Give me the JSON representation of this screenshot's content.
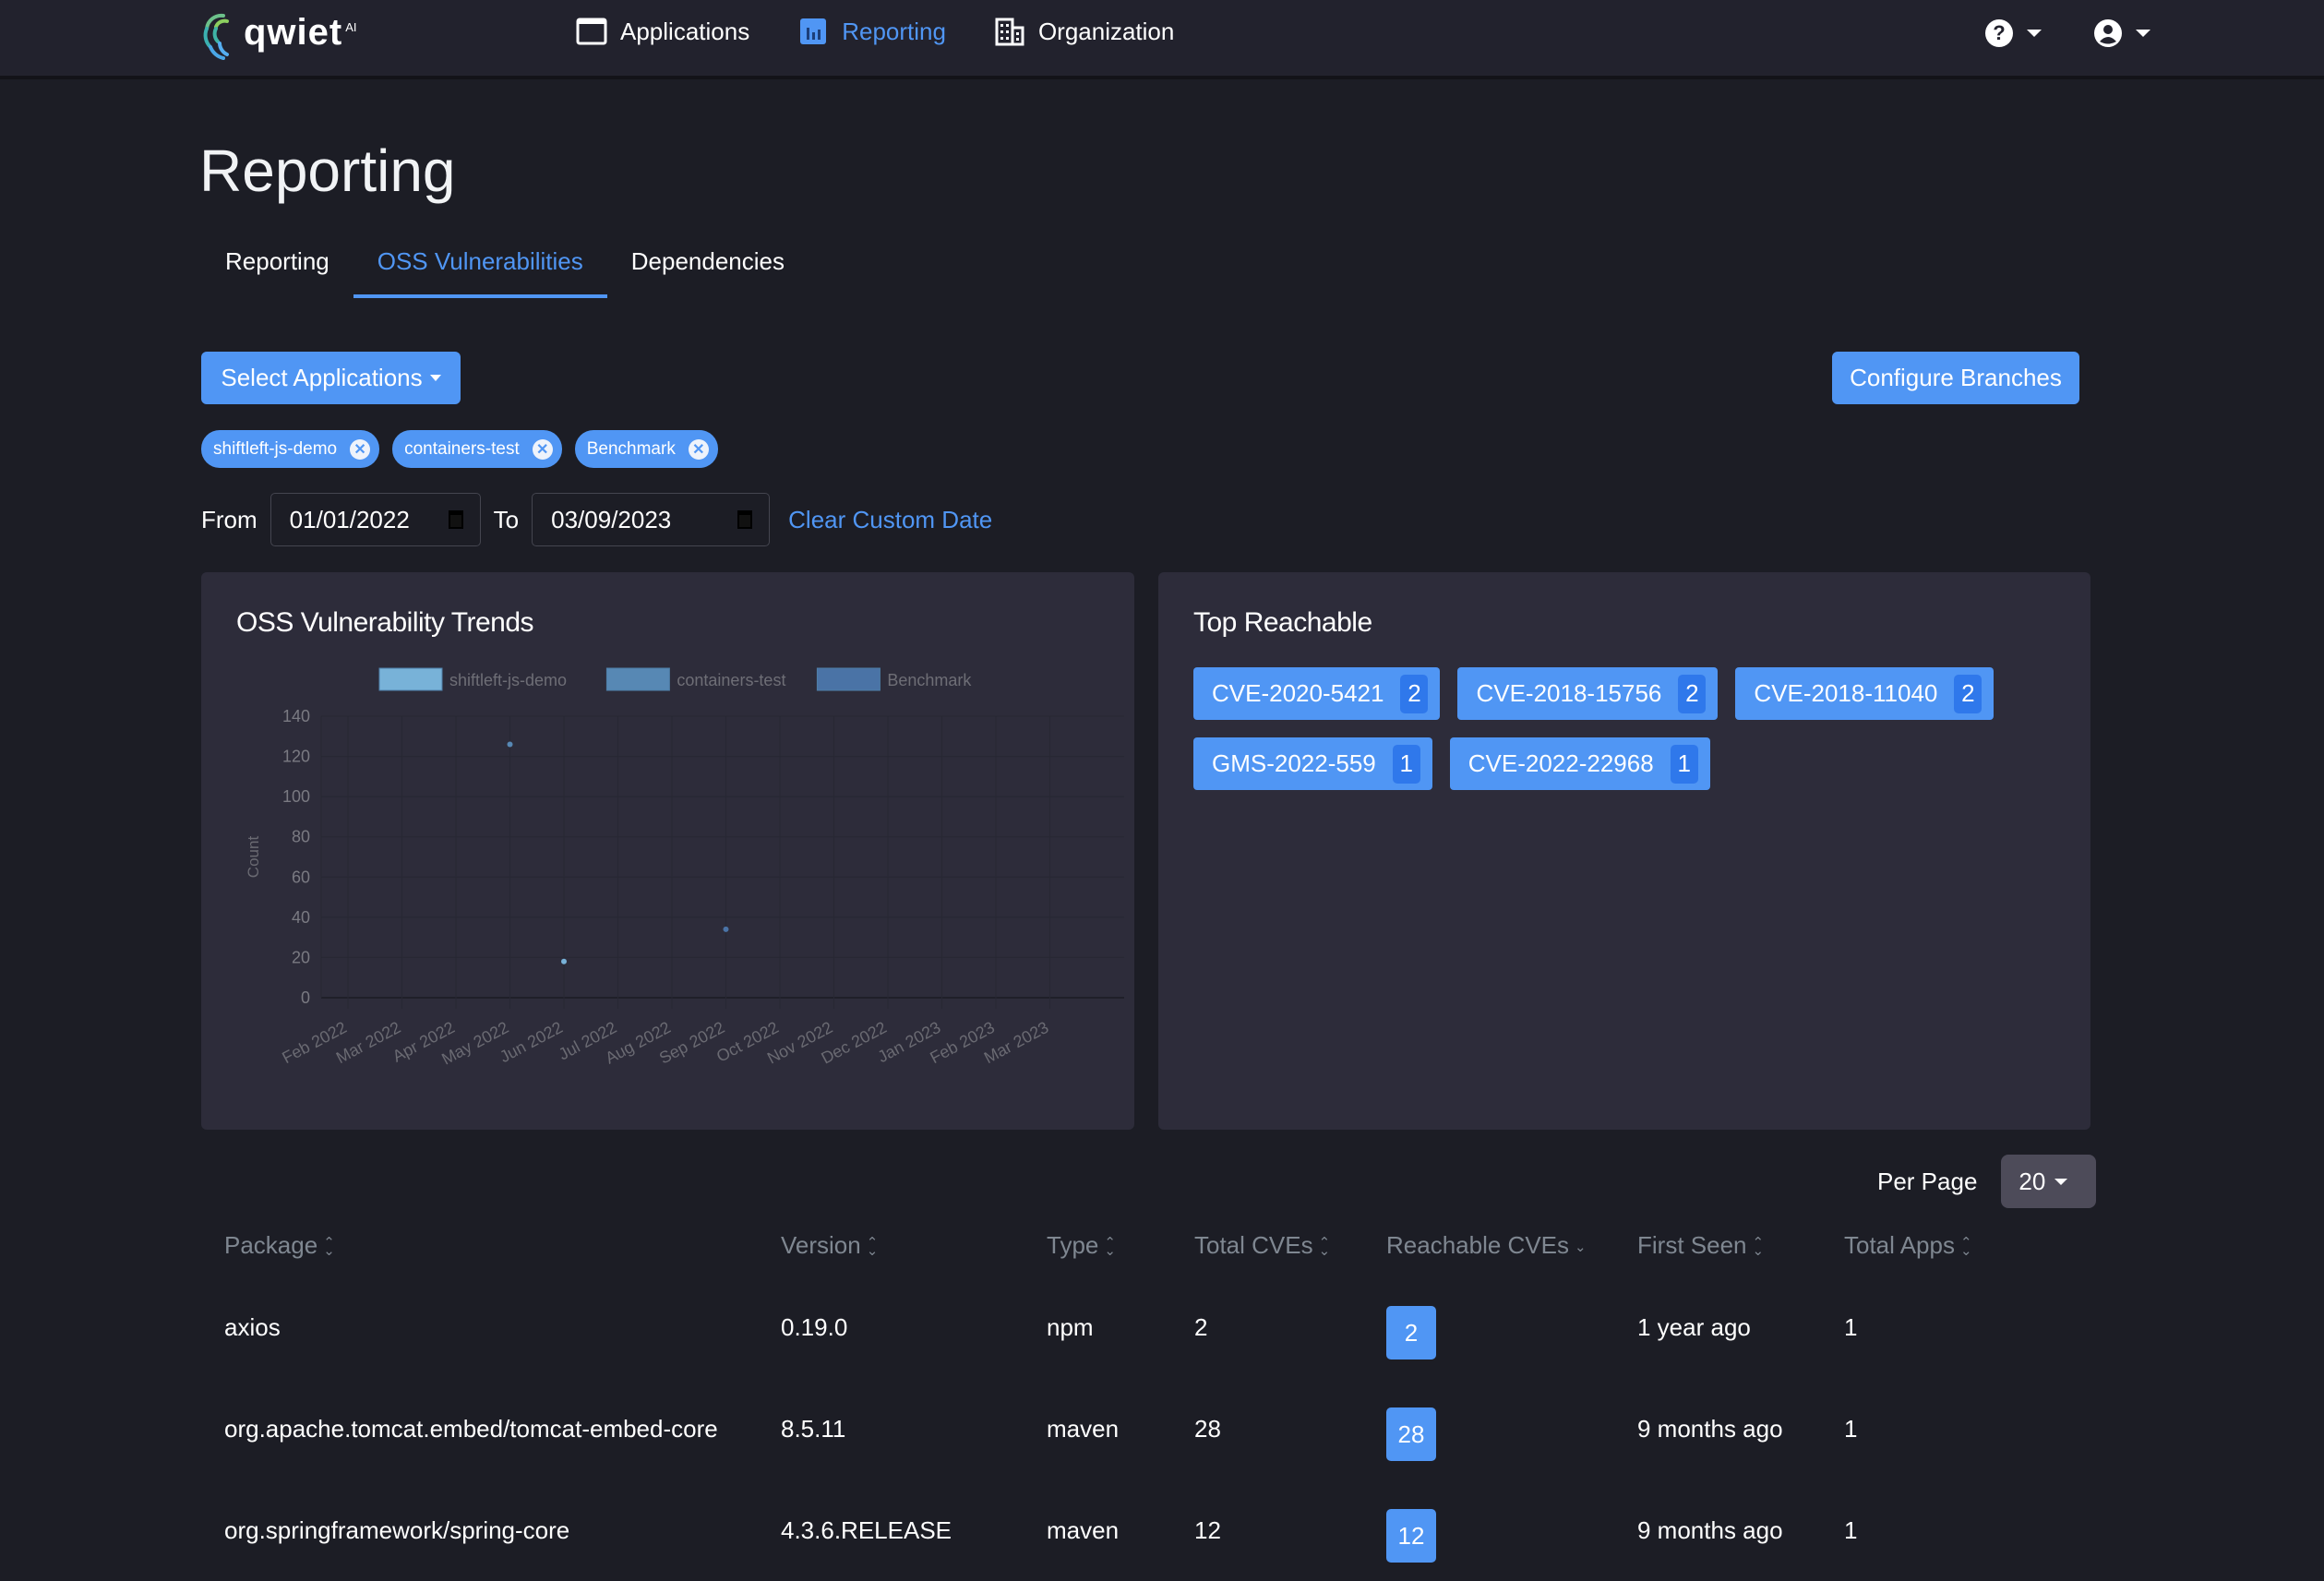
{
  "brand": {
    "name": "qwiet",
    "suffix": "AI"
  },
  "nav": {
    "items": [
      {
        "label": "Applications",
        "icon": "window-icon",
        "active": false
      },
      {
        "label": "Reporting",
        "icon": "bar-chart-icon",
        "active": true
      },
      {
        "label": "Organization",
        "icon": "building-icon",
        "active": false
      }
    ],
    "right": [
      {
        "icon": "help-icon",
        "caret": "chevron-down-icon"
      },
      {
        "icon": "user-icon",
        "caret": "chevron-down-icon"
      }
    ]
  },
  "page": {
    "title": "Reporting"
  },
  "tabs": [
    {
      "label": "Reporting",
      "active": false
    },
    {
      "label": "OSS Vulnerabilities",
      "active": true
    },
    {
      "label": "Dependencies",
      "active": false
    }
  ],
  "filters": {
    "select_applications_label": "Select Applications",
    "configure_branches_label": "Configure Branches",
    "selected_apps": [
      "shiftleft-js-demo",
      "containers-test",
      "Benchmark"
    ],
    "from_label": "From",
    "from_value": "01/01/2022",
    "to_label": "To",
    "to_value": "03/09/2023",
    "clear_label": "Clear Custom Date"
  },
  "trends": {
    "title": "OSS Vulnerability Trends"
  },
  "chart_data": {
    "type": "scatter",
    "title": "OSS Vulnerability Trends",
    "xlabel": "",
    "ylabel": "Count",
    "categories": [
      "Feb 2022",
      "Mar 2022",
      "Apr 2022",
      "May 2022",
      "Jun 2022",
      "Jul 2022",
      "Aug 2022",
      "Sep 2022",
      "Oct 2022",
      "Nov 2022",
      "Dec 2022",
      "Jan 2023",
      "Feb 2023",
      "Mar 2023"
    ],
    "ylim": [
      0,
      140
    ],
    "yticks": [
      0,
      20,
      40,
      60,
      80,
      100,
      120,
      140
    ],
    "grid": true,
    "legend": "top-center",
    "series": [
      {
        "name": "shiftleft-js-demo",
        "color": "#78b2d8",
        "points": [
          {
            "x": "Jun 2022",
            "y": 18
          }
        ]
      },
      {
        "name": "containers-test",
        "color": "#5788b4",
        "points": [
          {
            "x": "May 2022",
            "y": 126
          }
        ]
      },
      {
        "name": "Benchmark",
        "color": "#4a73a6",
        "points": [
          {
            "x": "Sep 2022",
            "y": 34
          }
        ]
      }
    ]
  },
  "top_reachable": {
    "title": "Top Reachable",
    "items": [
      {
        "id": "CVE-2020-5421",
        "count": "2"
      },
      {
        "id": "CVE-2018-15756",
        "count": "2"
      },
      {
        "id": "CVE-2018-11040",
        "count": "2"
      },
      {
        "id": "GMS-2022-559",
        "count": "1"
      },
      {
        "id": "CVE-2022-22968",
        "count": "1"
      }
    ]
  },
  "pagination": {
    "per_page_label": "Per Page",
    "per_page_value": "20"
  },
  "table": {
    "columns": [
      {
        "label": "Package",
        "sort": "both"
      },
      {
        "label": "Version",
        "sort": "both"
      },
      {
        "label": "Type",
        "sort": "both"
      },
      {
        "label": "Total CVEs",
        "sort": "both"
      },
      {
        "label": "Reachable CVEs",
        "sort": "desc"
      },
      {
        "label": "First Seen",
        "sort": "both"
      },
      {
        "label": "Total Apps",
        "sort": "both"
      }
    ],
    "rows": [
      {
        "package": "axios",
        "version": "0.19.0",
        "type": "npm",
        "total_cves": "2",
        "reachable_cves": "2",
        "first_seen": "1 year ago",
        "total_apps": "1"
      },
      {
        "package": "org.apache.tomcat.embed/tomcat-embed-core",
        "version": "8.5.11",
        "type": "maven",
        "total_cves": "28",
        "reachable_cves": "28",
        "first_seen": "9 months ago",
        "total_apps": "1"
      },
      {
        "package": "org.springframework/spring-core",
        "version": "4.3.6.RELEASE",
        "type": "maven",
        "total_cves": "12",
        "reachable_cves": "12",
        "first_seen": "9 months ago",
        "total_apps": "1"
      }
    ]
  },
  "colors": {
    "accent": "#5096f4",
    "background": "#1c1d25",
    "card": "#2d2c3a",
    "topbar": "#22222d"
  }
}
